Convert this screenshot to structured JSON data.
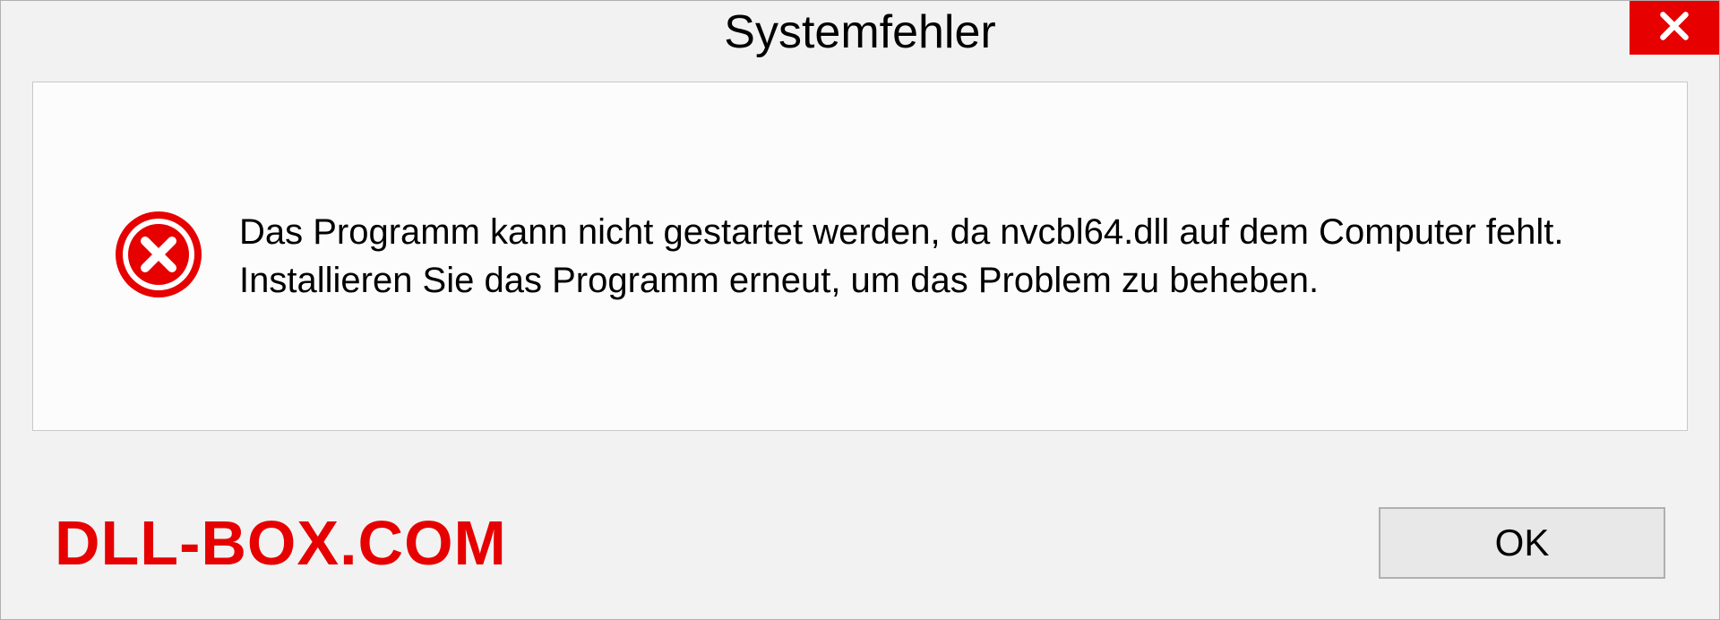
{
  "dialog": {
    "title": "Systemfehler",
    "message": "Das Programm kann nicht gestartet werden, da nvcbl64.dll auf dem Computer fehlt. Installieren Sie das Programm erneut, um das Problem zu beheben.",
    "ok_label": "OK"
  },
  "watermark": "DLL-BOX.COM",
  "colors": {
    "error_red": "#e60000",
    "bg": "#f2f2f2"
  }
}
